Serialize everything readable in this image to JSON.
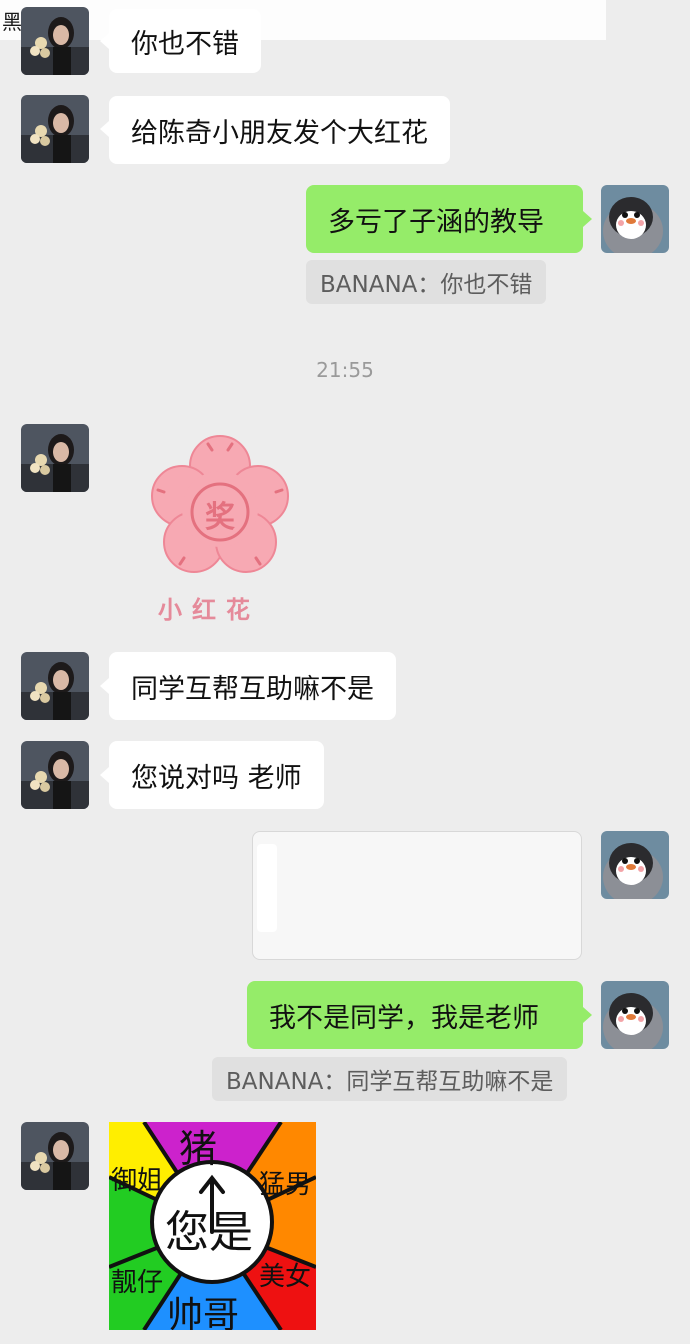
{
  "watermark": "黑料网",
  "messages": {
    "m1_text": "你也不错",
    "m2_text": "给陈奇小朋友发个大红花",
    "m3_text": "多亏了子涵的教导",
    "m3_quote": "BANANA：你也不错",
    "timestamp": "21:55",
    "m4_sticker_badge": "奖",
    "m4_sticker_caption": "小红花",
    "m5_text": "同学互帮互助嘛不是",
    "m6_text": "您说对吗 老师",
    "m8_text": "我不是同学，我是老师",
    "m8_quote": "BANANA：同学互帮互助嘛不是"
  },
  "wheel": {
    "center": "您是",
    "top": "猪",
    "upper_left": "御姐",
    "upper_right": "猛男",
    "lower_left": "靓仔",
    "lower_right": "美女",
    "bottom": "帅哥"
  },
  "colors": {
    "background": "#ededed",
    "bubble_left": "#ffffff",
    "bubble_right": "#95ec69",
    "quote_bg": "#e0e0e0",
    "timestamp": "#9a9a9a"
  },
  "icons": {
    "contact_avatar": "woman-with-flowers-avatar",
    "self_avatar": "penguin-avatar",
    "sticker": "red-flower-sticker",
    "wheel_sticker": "spinner-wheel-sticker"
  }
}
